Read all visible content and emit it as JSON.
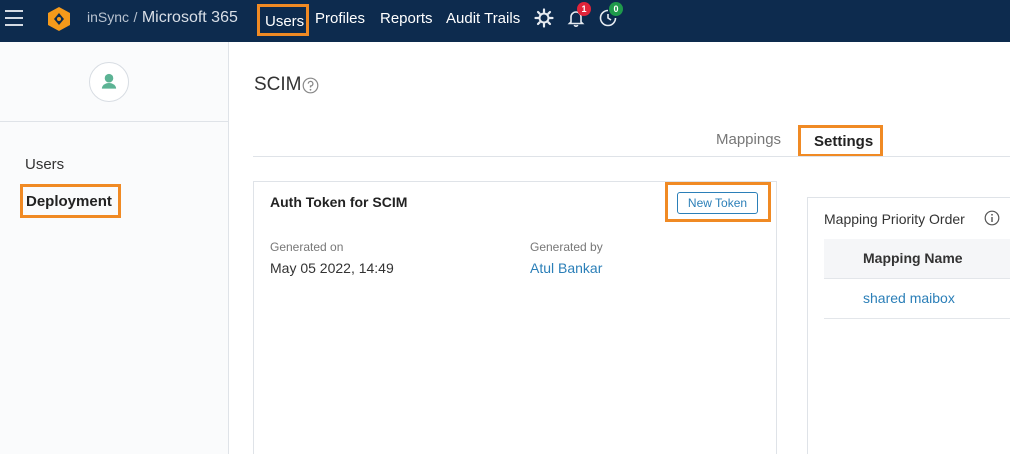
{
  "header": {
    "brand_prefix": "inSync",
    "brand_separator": "/",
    "brand_product": "Microsoft 365",
    "nav": [
      "Users",
      "Profiles",
      "Reports",
      "Audit Trails"
    ],
    "notifications_count": "1",
    "activity_count": "0",
    "accent": "#f08a24",
    "bar_color": "#0d2b4e"
  },
  "sidebar": {
    "items": [
      {
        "label": "Users"
      },
      {
        "label": "Deployment"
      }
    ]
  },
  "main": {
    "title": "SCIM",
    "tabs": [
      {
        "label": "Mappings"
      },
      {
        "label": "Settings"
      }
    ],
    "auth_card": {
      "title": "Auth Token for SCIM",
      "new_token_label": "New Token",
      "generated_on_label": "Generated on",
      "generated_on_value": "May 05 2022, 14:49",
      "generated_by_label": "Generated by",
      "generated_by_value": "Atul Bankar"
    },
    "priority_panel": {
      "title": "Mapping Priority Order",
      "column_header": "Mapping Name",
      "rows": [
        "shared maibox"
      ]
    }
  }
}
